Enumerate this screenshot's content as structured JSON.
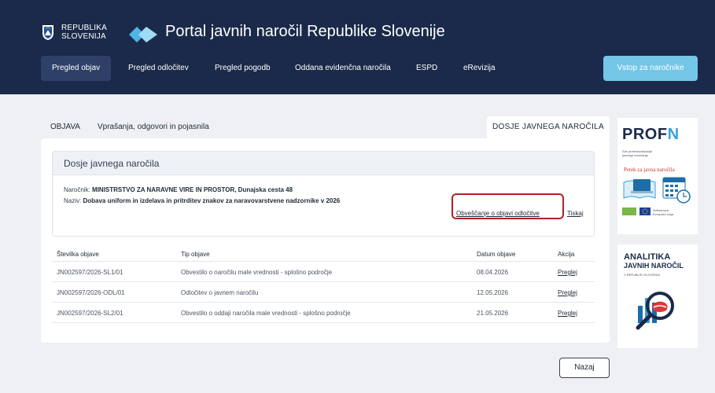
{
  "header": {
    "crest_line1": "REPUBLIKA",
    "crest_line2": "SLOVENIJA",
    "site_title": "Portal javnih naročil Republike Slovenije",
    "nav": [
      "Pregled objav",
      "Pregled odločitev",
      "Pregled pogodb",
      "Oddana evidenčna naročila",
      "ESPD",
      "eRevizija"
    ],
    "login_label": "Vstop za naročnike",
    "colors": {
      "header_bg": "#1b2a4a",
      "accent": "#74c6e6"
    }
  },
  "tabs": {
    "objava": "OBJAVA",
    "vprasanja": "Vprašanja, odgovori in pojasnila",
    "dosje": "DOSJE JAVNEGA NAROČILA"
  },
  "dosje": {
    "title": "Dosje javnega naročila",
    "narocnik_label": "Naročnik:",
    "narocnik_value": "MINISTRSTVO ZA NARAVNE VIRE IN PROSTOR, Dunajska cesta 48",
    "naziv_label": "Naziv:",
    "naziv_value": "Dobava uniform in izdelava in pritrditev znakov za naravovarstvene nadzornike v 2026",
    "link_obvescanje": "Obveščanje o objavi odločitve",
    "link_tiskaj": "Tiskaj",
    "highlight_color": "#b32025"
  },
  "table": {
    "headers": [
      "Številka objave",
      "Tip objave",
      "Datum objave",
      "Akcija"
    ],
    "rows": [
      {
        "stevilka": "JN002597/2026-SL1/01",
        "tip": "Obvestilo o naročilu male vrednosti - splošno področje",
        "datum": "08.04.2026",
        "akcija": "Preglej"
      },
      {
        "stevilka": "JN002597/2026-ODL/01",
        "tip": "Odločitev o javnem naročilu",
        "datum": "12.05.2026",
        "akcija": "Preglej"
      },
      {
        "stevilka": "JN002597/2026-SL2/01",
        "tip": "Obvestilo o oddaji naročila male vrednosti - splošno področje",
        "datum": "21.05.2026",
        "akcija": "Preglej"
      }
    ]
  },
  "back_label": "Nazaj",
  "ads": {
    "prof_title": "PROF",
    "prof_n": "N",
    "prof_sub": "Petek za javna naročila",
    "prof_small1": "Svit profesionalizacije",
    "prof_small2": "javnega naročanja",
    "eu_small1": "Sofinancira",
    "eu_small2": "Evropska unija",
    "analitika_line1": "ANALITIKA",
    "analitika_line2": "JAVNIH NAROČIL",
    "analitika_sub": "V REPUBLIKI SLOVENIJI"
  }
}
